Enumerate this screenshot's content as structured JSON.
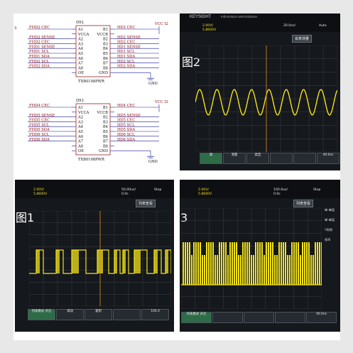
{
  "schematic": {
    "u92": {
      "designator": "D92",
      "part": "TXB0108PWR",
      "vcc_net": "VCC_I2",
      "left_nets": [
        "FHD2_CEC",
        "FHD2_SENSE",
        "FHD2_CEC",
        "FHD1_SENSE",
        "FHD1_SCL",
        "FHD1_SDA",
        "FHD2_SCL",
        "FHD2_SDA"
      ],
      "right_nets": [
        "HD2_CEC",
        "HD2_SENSE",
        "HD2_CEC",
        "HD1_SENSE",
        "HD1_SCL",
        "HD1_SDA",
        "HD2_SCL",
        "HD2_SDA"
      ],
      "left_pins": [
        "A1",
        "VCCA",
        "A2",
        "A3",
        "A4",
        "A5",
        "A6",
        "A7",
        "A8",
        "OE"
      ],
      "right_pins": [
        "B1",
        "VCCB",
        "B2",
        "B3",
        "B4",
        "B5",
        "B6",
        "B7",
        "B8",
        "GND"
      ],
      "gnd": "GND"
    },
    "u93": {
      "designator": "D93",
      "part": "TXB0108PWR",
      "vcc_net": "VCC_I2",
      "left_nets": [
        "FHD4_CEC",
        "FHD5_SENSE",
        "FHD5_CEC",
        "FHD5_SCL",
        "FHD5_SDA",
        "FHD6_SCL",
        "FHD6_SDA"
      ],
      "right_nets": [
        "HD4_CEC",
        "HD5_SENSE",
        "HD5_CEC",
        "HD5_SCL",
        "HD5_SDA",
        "HD6_SCL",
        "HD6_SDA"
      ],
      "left_pins": [
        "A1",
        "VCCA",
        "A2",
        "A3",
        "A4",
        "A5",
        "A6",
        "A7",
        "A8",
        "OE"
      ],
      "right_pins": [
        "B1",
        "VCCB",
        "B2",
        "B3",
        "B4",
        "B5",
        "B6",
        "B7",
        "B8",
        "GND"
      ],
      "gnd": "GND"
    },
    "edge_mark": "3"
  },
  "fig2": {
    "label": "图2",
    "brand": "KEYSIGHT",
    "model": "InfiniiVision MSOX3054A",
    "ch_scale": "2.00V/",
    "ch_offset": "5.8600V",
    "time_scale": "20.0ns/",
    "menu_title": "肖表测量",
    "softkeys": [
      "源",
      "测量",
      "类型",
      "",
      "",
      "40.0ns"
    ],
    "status": "Auto"
  },
  "fig1": {
    "label": "图1",
    "ch_scale": "2.00V/",
    "ch_offset": "5.8600V",
    "time_scale": "50.00us/",
    "time_offset": "0.0s",
    "menu_title": "列表查看",
    "softkeys": [
      "列表模式 开启",
      "滚动",
      "复制",
      "",
      "100.0"
    ],
    "status": "Stop"
  },
  "fig3": {
    "label": "3",
    "ch_scale": "2.00V/",
    "ch_offset": "5.8600V",
    "time_scale": "100.0us/",
    "time_offset": "0.0s",
    "menu_title": "列表查看",
    "side_items": [
      "峰-峰值",
      "峰-峰值",
      "Y周期",
      "频率"
    ],
    "softkeys": [
      "列表模式 开启",
      "",
      "",
      "",
      "40.0ns"
    ],
    "status": "Stop"
  },
  "colors": {
    "trace": "#f2e21a",
    "grid": "#3c4046",
    "schematic_line": "#1a1a9a",
    "net_text": "#8b0000"
  }
}
